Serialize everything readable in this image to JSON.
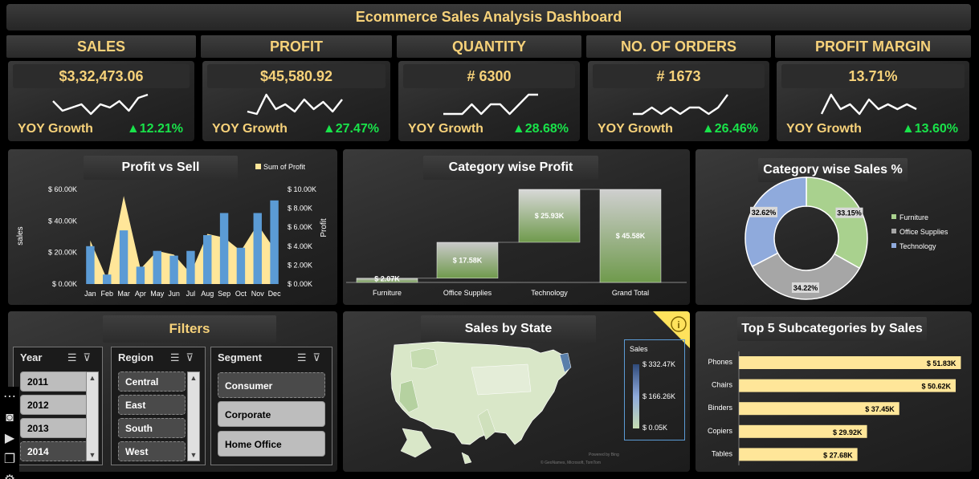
{
  "dashboard": {
    "title": "Ecommerce Sales Analysis Dashboard"
  },
  "kpis": [
    {
      "label": "SALES",
      "value": "$3,32,473.06",
      "yoy_label": "YOY Growth",
      "yoy": "▲12.21%",
      "spark": [
        6,
        3,
        4,
        5,
        2,
        5,
        4,
        6,
        3,
        7,
        8
      ]
    },
    {
      "label": "PROFIT",
      "value": "$45,580.92",
      "yoy_label": "YOY Growth",
      "yoy": "▲27.47%",
      "spark": [
        2,
        1,
        9,
        3,
        5,
        2,
        7,
        3,
        6,
        2,
        7
      ]
    },
    {
      "label": "QUANTITY",
      "value": "# 6300",
      "yoy_label": "YOY Growth",
      "yoy": "▲28.68%",
      "spark": [
        3,
        3,
        3,
        4,
        3,
        4,
        4,
        3,
        4,
        5,
        5
      ]
    },
    {
      "label": "NO. OF ORDERS",
      "value": "# 1673",
      "yoy_label": "YOY Growth",
      "yoy": "▲26.46%",
      "spark": [
        3,
        3,
        4,
        3,
        4,
        3,
        4,
        4,
        3,
        4,
        6
      ]
    },
    {
      "label": "PROFIT MARGIN",
      "value": "13.71%",
      "yoy_label": "YOY Growth",
      "yoy": "▲13.60%",
      "spark": [
        2,
        6,
        3,
        4,
        2,
        5,
        3,
        4,
        3,
        4,
        3
      ]
    }
  ],
  "profit_vs_sell": {
    "title": "Profit vs Sell",
    "legend": "Sum of Profit",
    "ylabel_left": "sales",
    "ylabel_right": "Profit",
    "left_ticks": [
      "$ 60.00K",
      "$ 40.00K",
      "$ 20.00K",
      "$ 0.00K"
    ],
    "right_ticks": [
      "$ 10.00K",
      "$ 8.00K",
      "$ 6.00K",
      "$ 4.00K",
      "$ 2.00K",
      "$ 0.00K"
    ]
  },
  "category_profit": {
    "title": "Category wise Profit"
  },
  "category_sales": {
    "title": "Category wise Sales %"
  },
  "sales_by_state": {
    "title": "Sales by State",
    "legend_title": "Sales",
    "legend_ticks": [
      "$ 332.47K",
      "$ 166.26K",
      "$ 0.05K"
    ],
    "credit": "© GeoNames, Microsoft, TomTom",
    "credit2": "Powered by Bing"
  },
  "top_subcategories": {
    "title": "Top 5 Subcategories by Sales"
  },
  "filters": {
    "title": "Filters",
    "year": {
      "label": "Year",
      "items": [
        "2011",
        "2012",
        "2013",
        "2014"
      ]
    },
    "region": {
      "label": "Region",
      "items": [
        "Central",
        "East",
        "South",
        "West"
      ]
    },
    "segment": {
      "label": "Segment",
      "items": [
        "Consumer",
        "Corporate",
        "Home Office"
      ]
    }
  },
  "chart_data": [
    {
      "type": "bar",
      "title": "Profit vs Sell",
      "categories": [
        "Jan",
        "Feb",
        "Mar",
        "Apr",
        "May",
        "Jun",
        "Jul",
        "Aug",
        "Sep",
        "Oct",
        "Nov",
        "Dec"
      ],
      "series": [
        {
          "name": "Sales",
          "axis": "left",
          "color": "#5b9bd5",
          "values": [
            24,
            6,
            34,
            11,
            21,
            18,
            21,
            31,
            45,
            23,
            45,
            53
          ]
        },
        {
          "name": "Sum of Profit",
          "axis": "right",
          "color": "#ffe699",
          "values": [
            4.6,
            0.5,
            9.3,
            1.6,
            3.5,
            3.1,
            1.1,
            5.3,
            4.9,
            3.5,
            6.3,
            3.7
          ]
        }
      ],
      "ylim_left": [
        0,
        60
      ],
      "ylim_right": [
        0,
        10
      ],
      "ylabel": "sales",
      "y2label": "Profit",
      "legend": "top-right"
    },
    {
      "type": "bar",
      "title": "Category wise Profit",
      "subtype": "waterfall",
      "categories": [
        "Furniture",
        "Office Supplies",
        "Technology",
        "Grand Total"
      ],
      "values": [
        2.07,
        17.58,
        25.93,
        45.58
      ],
      "labels": [
        "$ 2.07K",
        "$ 17.58K",
        "$ 25.93K",
        "$ 45.58K"
      ]
    },
    {
      "type": "pie",
      "title": "Category wise Sales %",
      "categories": [
        "Furniture",
        "Office Supplies",
        "Technology"
      ],
      "values": [
        33.15,
        34.22,
        32.62
      ],
      "labels": [
        "33.15%",
        "34.22%",
        "32.62%"
      ],
      "colors": [
        "#a9d18e",
        "#a6a6a6",
        "#8faadc"
      ],
      "legend": "right"
    },
    {
      "type": "bar",
      "title": "Top 5 Subcategories by Sales",
      "orientation": "horizontal",
      "categories": [
        "Phones",
        "Chairs",
        "Binders",
        "Copiers",
        "Tables"
      ],
      "values": [
        51.83,
        50.62,
        37.45,
        29.92,
        27.68
      ],
      "labels": [
        "$ 51.83K",
        "$ 50.62K",
        "$ 37.45K",
        "$ 29.92K",
        "$ 27.68K"
      ],
      "color": "#ffe699"
    }
  ]
}
